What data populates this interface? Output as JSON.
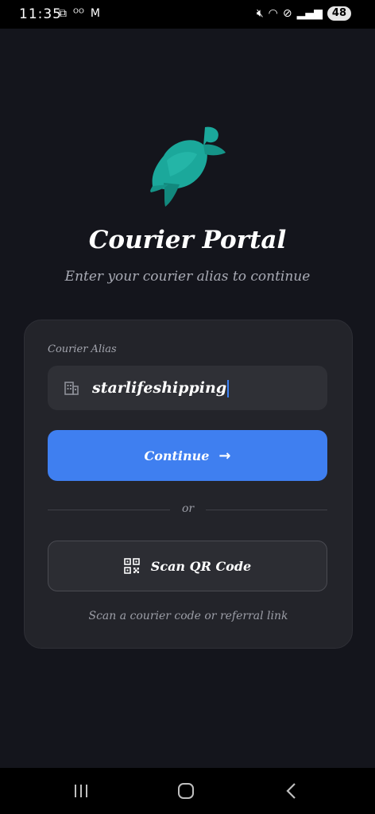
{
  "status_bar": {
    "time": "11:35",
    "left_icons": [
      "screen-record-icon",
      "voicemail-icon",
      "gmail-icon"
    ],
    "right_icons": [
      "mute-icon",
      "wifi-icon",
      "dnd-icon",
      "signal-icon"
    ],
    "battery": "48"
  },
  "header": {
    "title": "Courier Portal",
    "subtitle": "Enter your courier alias to continue",
    "logo_icon": "sea-turtle-icon",
    "logo_color": "#1ba89b"
  },
  "form": {
    "alias_label": "Courier Alias",
    "alias_icon": "building-icon",
    "alias_value": "starlifeshipping",
    "continue_label": "Continue",
    "continue_icon": "arrow-right-icon",
    "continue_color": "#3f7ff0",
    "divider_text": "or",
    "scan_label": "Scan QR Code",
    "scan_icon": "qr-code-icon",
    "helper_text": "Scan a courier code or referral link"
  },
  "nav_bar": {
    "icons": [
      "recent-apps-icon",
      "home-icon",
      "back-icon"
    ]
  }
}
